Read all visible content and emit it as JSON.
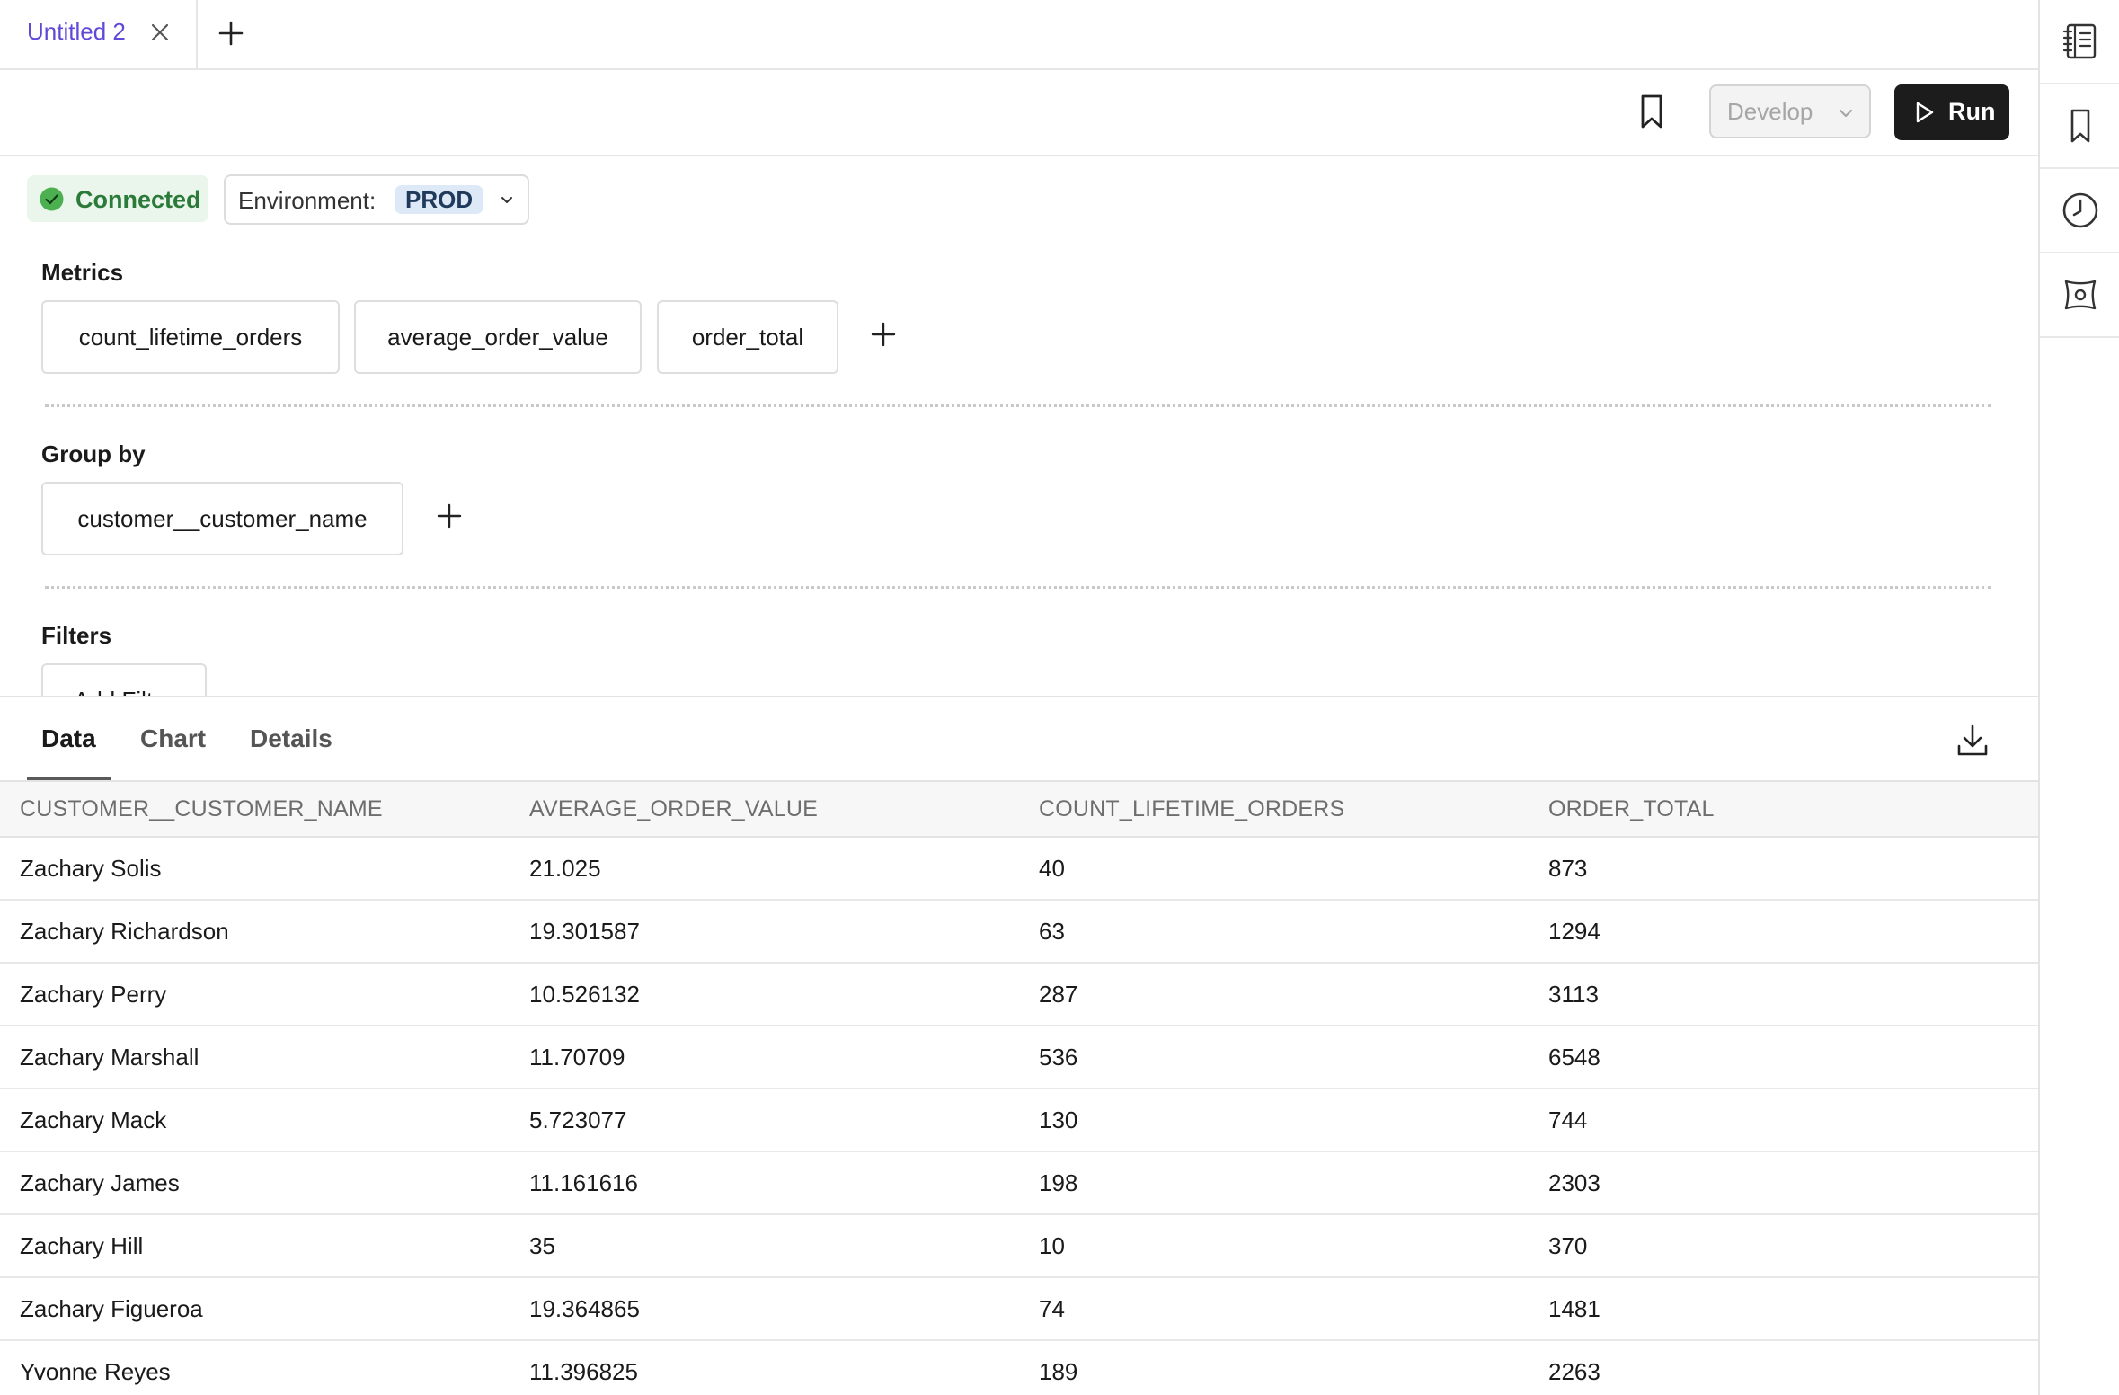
{
  "tabs": {
    "active_label": "Untitled 2"
  },
  "toolbar": {
    "develop_label": "Develop",
    "run_label": "Run"
  },
  "connection": {
    "status": "Connected",
    "environment_label": "Environment:",
    "environment_value": "PROD"
  },
  "metrics": {
    "title": "Metrics",
    "items": [
      "count_lifetime_orders",
      "average_order_value",
      "order_total"
    ]
  },
  "group_by": {
    "title": "Group by",
    "items": [
      "customer__customer_name"
    ]
  },
  "filters": {
    "title": "Filters",
    "add_label": "Add Filter"
  },
  "results": {
    "tabs": [
      "Data",
      "Chart",
      "Details"
    ],
    "active_tab": "Data",
    "columns": [
      "CUSTOMER__CUSTOMER_NAME",
      "AVERAGE_ORDER_VALUE",
      "COUNT_LIFETIME_ORDERS",
      "ORDER_TOTAL"
    ],
    "rows": [
      [
        "Zachary Solis",
        "21.025",
        "40",
        "873"
      ],
      [
        "Zachary Richardson",
        "19.301587",
        "63",
        "1294"
      ],
      [
        "Zachary Perry",
        "10.526132",
        "287",
        "3113"
      ],
      [
        "Zachary Marshall",
        "11.70709",
        "536",
        "6548"
      ],
      [
        "Zachary Mack",
        "5.723077",
        "130",
        "744"
      ],
      [
        "Zachary James",
        "11.161616",
        "198",
        "2303"
      ],
      [
        "Zachary Hill",
        "35",
        "10",
        "370"
      ],
      [
        "Zachary Figueroa",
        "19.364865",
        "74",
        "1481"
      ],
      [
        "Yvonne Reyes",
        "11.396825",
        "189",
        "2263"
      ]
    ]
  },
  "colors": {
    "accent": "#6048d9",
    "connected_bg": "#eaf6ec",
    "connected_text": "#2b7a3a",
    "connected_dot": "#4caf50",
    "env_badge_bg": "#dde9f7",
    "run_bg": "#1c1c1c"
  },
  "icons": {
    "tab_close": "close-icon",
    "new_tab": "plus-icon",
    "bookmark": "bookmark-icon",
    "develop_chevron": "chevron-down-icon",
    "run": "play-icon",
    "connected": "check-circle-icon",
    "env_chevron": "chevron-down-icon",
    "add": "plus-icon",
    "download": "download-icon",
    "rail": [
      "notebook-icon",
      "bookmark-icon",
      "history-icon",
      "integration-icon"
    ]
  }
}
